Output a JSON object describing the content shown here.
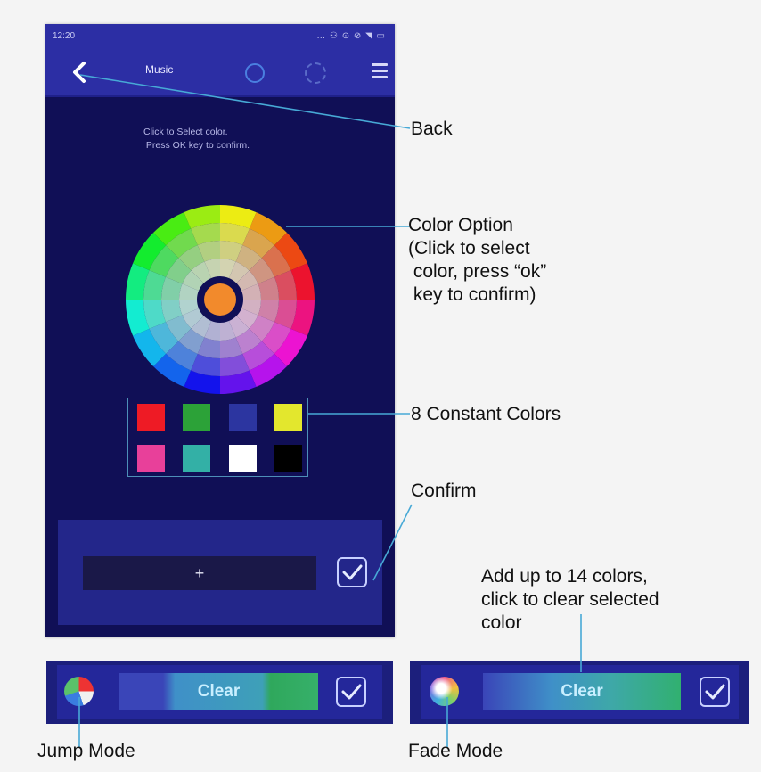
{
  "status": {
    "time": "12:20",
    "icons": "… ⚇ ⊙ ⊘ ◥ ▭"
  },
  "nav": {
    "title": "Music"
  },
  "instruction": "Click to Select color.\n Press OK key to confirm.",
  "add_button": "+",
  "constant_colors": [
    "#ee1b25",
    "#2ca238",
    "#2c35a0",
    "#e3e72d",
    "#e8409a",
    "#33b0a6",
    "#ffffff",
    "#000000"
  ],
  "callouts": {
    "back": "Back",
    "color_option": "Color Option\n(Click to select\n color, press “ok”\n key to confirm)",
    "constant_colors": "8 Constant Colors",
    "confirm": "Confirm",
    "add_colors": "Add up to 14 colors,\nclick to clear selected\ncolor",
    "jump_mode": "Jump Mode",
    "fade_mode": "Fade Mode"
  },
  "jump_strip": {
    "clear_label": "Clear"
  },
  "fade_strip": {
    "clear_label": "Clear"
  },
  "colors": {
    "nav_bg": "#2c2ea4",
    "screen_bg": "#100f56",
    "callout_line": "#47a9d6"
  }
}
